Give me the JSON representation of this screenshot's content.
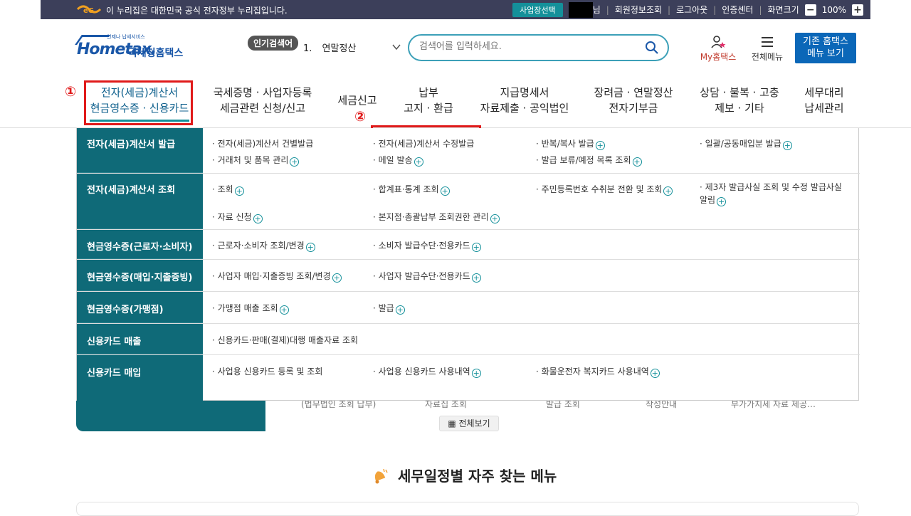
{
  "topbar": {
    "notice": "이 누리집은 대한민국 공식 전자정부 누리집입니다.",
    "biz_select": "사업장선택",
    "user_suffix": "님",
    "member_info": "회원정보조회",
    "logout": "로그아웃",
    "cert_center": "인증센터",
    "screen_size": "화면크기",
    "zoom": "100%",
    "minus": "−",
    "plus": "+"
  },
  "header": {
    "logo_sub": "언제나 납세서비스",
    "logo_brand": "Hometax.",
    "logo_kr": "국세청홈택스",
    "popular_label": "인기검색어",
    "popular_rank": "1.",
    "popular_term": "연말정산",
    "search_placeholder": "검색어를 입력하세요.",
    "my_hometax": "My홈택스",
    "all_menu": "전체메뉴",
    "old_hometax_line1": "기존 홈택스",
    "old_hometax_line2": "메뉴 보기"
  },
  "gnb": [
    {
      "line1": "전자(세금)계산서",
      "line2": "현금영수증 · 신용카드"
    },
    {
      "line1": "국세증명 · 사업자등록",
      "line2": "세금관련 신청/신고"
    },
    {
      "line1": "세금신고",
      "line2": ""
    },
    {
      "line1": "납부",
      "line2": "고지 · 환급"
    },
    {
      "line1": "지급명세서",
      "line2": "자료제출 · 공익법인"
    },
    {
      "line1": "장려금 · 연말정산",
      "line2": "전자기부금"
    },
    {
      "line1": "상담 · 불복 · 고충",
      "line2": "제보 · 기타"
    },
    {
      "line1": "세무대리",
      "line2": "납세관리"
    }
  ],
  "annotations": {
    "step1": "①",
    "step2": "②"
  },
  "mega": {
    "rows": [
      {
        "header": "전자(세금)계산서 발급",
        "links": [
          "· 전자(세금)계산서 건별발급",
          "· 전자(세금)계산서 수정발급",
          "· 반복/복사 발급",
          "· 일괄/공동매입분 발급",
          "· 거래처 및 품목 관리",
          "· 메일 발송",
          "· 발급 보류/예정 목록 조회"
        ]
      },
      {
        "header": "전자(세금)계산서 조회",
        "links": [
          "· 조회",
          "· 합계표·통계 조회",
          "· 주민등록번호 수취분 전환 및 조회",
          "· 제3자 발급사실 조회 및 수정 발급사실 알림",
          "· 자료 신청",
          "· 본지점·총괄납부 조회권한 관리"
        ]
      },
      {
        "header": "현금영수증(근로자·소비자)",
        "links": [
          "· 근로자·소비자 조회/변경",
          "· 소비자 발급수단·전용카드"
        ]
      },
      {
        "header": "현금영수증(매입·지출증빙)",
        "links": [
          "· 사업자 매입·지출증빙 조회/변경",
          "· 사업자 발급수단·전용카드"
        ]
      },
      {
        "header": "현금영수증(가맹점)",
        "links": [
          "· 가맹점 매출 조회",
          "· 발급"
        ]
      },
      {
        "header": "신용카드 매출",
        "links": [
          "· 신용카드·판매(결제)대행 매출자료 조회"
        ]
      },
      {
        "header": "신용카드 매입",
        "links": [
          "· 사업용 신용카드 등록 및 조회",
          "· 사업용 신용카드 사용내역",
          "· 화물운전자 복지카드 사용내역"
        ]
      }
    ]
  },
  "behind": {
    "peek": [
      "(법무법인 조회 납부)",
      "자료집 조회",
      "발급 조회",
      "작성안내",
      "부가가치세 자료 제공…"
    ],
    "view_all": "전체보기"
  },
  "section": {
    "title": "세무일정별 자주 찾는 메뉴"
  },
  "colors": {
    "topbar": "#3c3f5a",
    "teal": "#0f6a78",
    "accent": "#14909a",
    "brand": "#1a57a8",
    "annotation": "#e01a1a"
  }
}
